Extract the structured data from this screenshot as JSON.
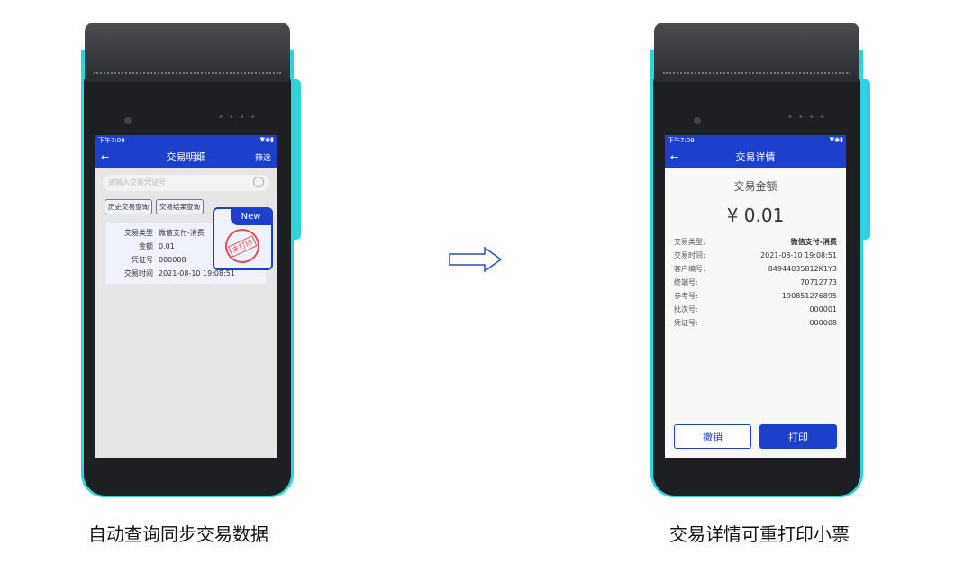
{
  "left": {
    "status_time": "下午7:09",
    "title": "交易明细",
    "filter": "筛选",
    "search_placeholder": "请输入交易凭证号",
    "buttons": [
      "历史交易查询",
      "交易结果查询"
    ],
    "record": [
      {
        "k": "交易类型",
        "v": "微信支付-消费"
      },
      {
        "k": "金额",
        "v": "0.01"
      },
      {
        "k": "凭证号",
        "v": "000008"
      },
      {
        "k": "交易时间",
        "v": "2021-08-10 19:08:51"
      }
    ],
    "new_badge": "New",
    "stamp": "未打印",
    "caption": "自动查询同步交易数据"
  },
  "right": {
    "status_time": "下午7:09",
    "title": "交易详情",
    "amount_label": "交易金额",
    "amount": "¥ 0.01",
    "rows": [
      {
        "k": "交易类型:",
        "v": "微信支付-消费"
      },
      {
        "k": "交易时间:",
        "v": "2021-08-10 19:08:51"
      },
      {
        "k": "客户编号:",
        "v": "84944035812K1Y3"
      },
      {
        "k": "终端号:",
        "v": "70712773"
      },
      {
        "k": "参考号:",
        "v": "190851276895"
      },
      {
        "k": "批次号:",
        "v": "000001"
      },
      {
        "k": "凭证号:",
        "v": "000008"
      }
    ],
    "cancel": "撤销",
    "print": "打印",
    "caption": "交易详情可重打印小票"
  },
  "colors": {
    "primary": "#1c3fcc",
    "device_accent": "#2fd3e0",
    "stamp": "#e0505a"
  }
}
